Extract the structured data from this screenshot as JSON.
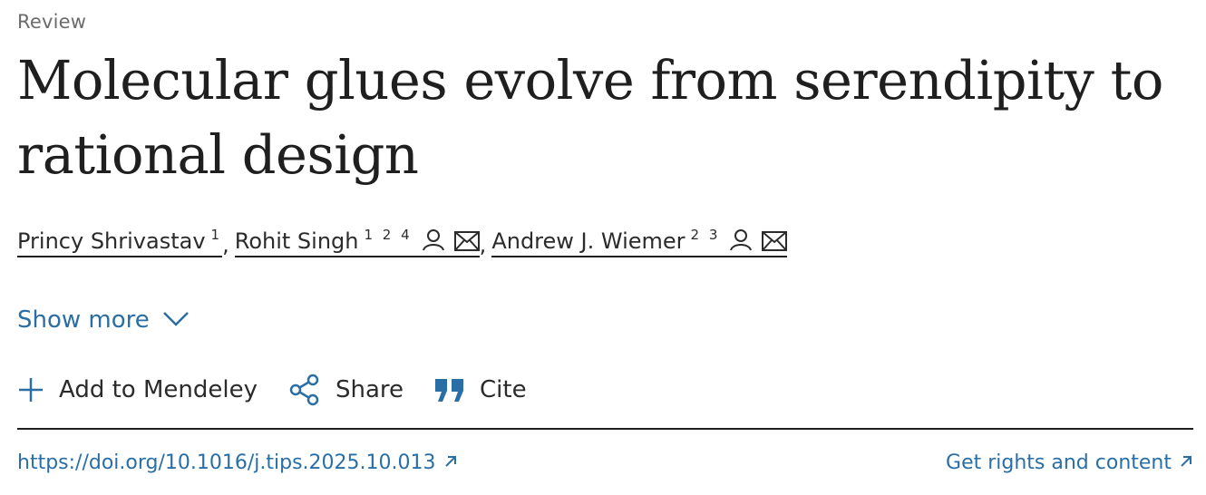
{
  "article": {
    "type": "Review",
    "title": "Molecular glues evolve from serendipity to rational design"
  },
  "authors": [
    {
      "name": "Princy Shrivastav",
      "affiliations": "1",
      "icons": []
    },
    {
      "name": "Rohit Singh",
      "affiliations": "1 2 4",
      "icons": [
        "person-icon",
        "envelope-icon"
      ]
    },
    {
      "name": "Andrew J. Wiemer",
      "affiliations": "2 3",
      "icons": [
        "person-icon",
        "envelope-icon"
      ]
    }
  ],
  "separators": {
    "comma": ","
  },
  "show_more": {
    "label": "Show more",
    "icon": "chevron-down-icon"
  },
  "actions": {
    "mendeley": {
      "label": "Add to Mendeley",
      "icon": "plus-icon"
    },
    "share": {
      "label": "Share",
      "icon": "share-icon"
    },
    "cite": {
      "label": "Cite",
      "icon": "quote-icon"
    }
  },
  "links": {
    "doi": "https://doi.org/10.1016/j.tips.2025.10.013",
    "rights": "Get rights and content",
    "external_icon": "external-arrow-icon"
  },
  "colors": {
    "link": "#2a6ea6",
    "text": "#1f1f1f",
    "muted": "#6b6b6b"
  }
}
